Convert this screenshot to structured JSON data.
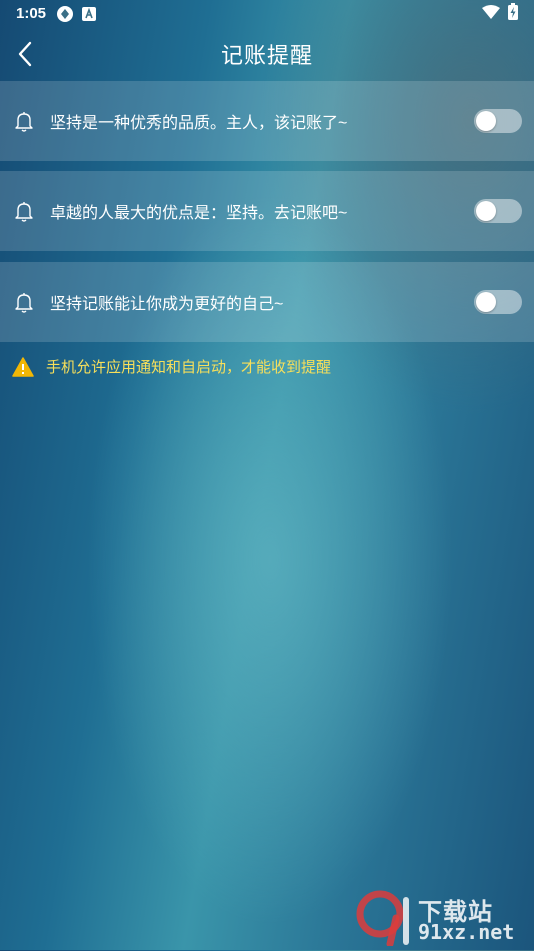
{
  "status_bar": {
    "time": "1:05",
    "icons": [
      "aperture-icon",
      "a-badge-icon",
      "wifi-icon",
      "battery-charging-icon"
    ]
  },
  "header": {
    "title": "记账提醒",
    "back_icon": "back-chevron-icon"
  },
  "reminders": [
    {
      "label": "坚持是一种优秀的品质。主人，该记账了~",
      "enabled": false,
      "icon": "bell-icon"
    },
    {
      "label": "卓越的人最大的优点是：坚持。去记账吧~",
      "enabled": false,
      "icon": "bell-icon"
    },
    {
      "label": "坚持记账能让你成为更好的自己~",
      "enabled": false,
      "icon": "bell-icon"
    }
  ],
  "notice": {
    "icon": "warning-icon",
    "text": "手机允许应用通知和自启动，才能收到提醒",
    "color": "#f7df5a"
  },
  "watermark": {
    "top_text": "下载站",
    "bottom_text": "91xz.net"
  },
  "colors": {
    "toggle_track": "#b5c4cc",
    "toggle_knob": "#ffffff",
    "row_overlay": "rgba(255,255,255,0.16)"
  }
}
